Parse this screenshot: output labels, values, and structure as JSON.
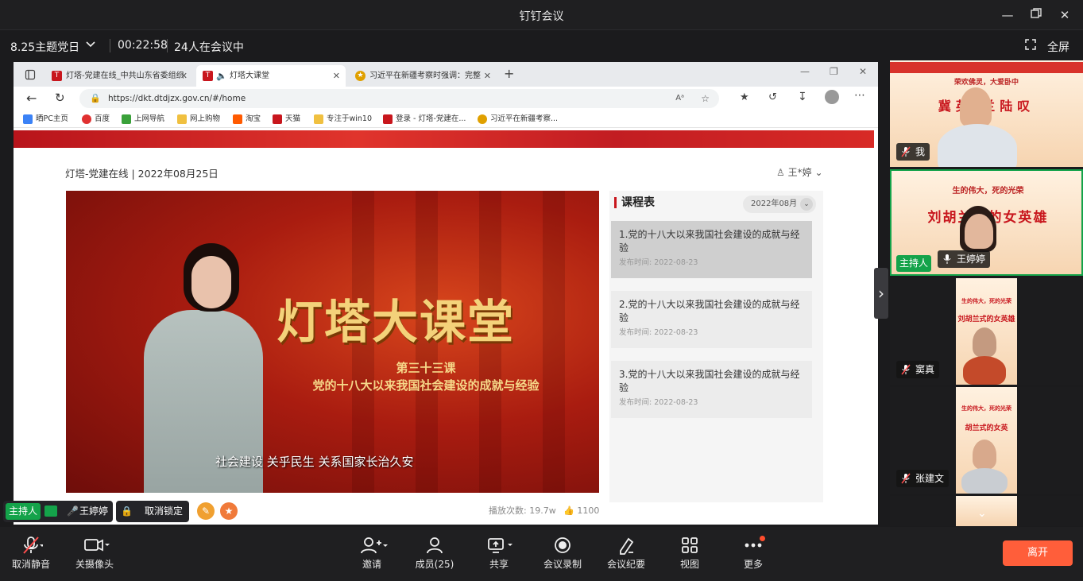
{
  "window": {
    "title": "钉钉会议"
  },
  "meeting": {
    "name": "8.25主题党日",
    "timer": "00:22:58",
    "count": "24人在会议中",
    "fullscreen_label": "全屏"
  },
  "browser": {
    "tabs": [
      {
        "label": "灯塔-党建在线_中共山东省委组织"
      },
      {
        "label": "灯塔大课堂"
      },
      {
        "label": "习近平在新疆考察时强调：完整"
      }
    ],
    "url": "https://dkt.dtdjzx.gov.cn/#/home",
    "bookmarks": [
      "晒PC主页",
      "百度",
      "上网导航",
      "网上购物",
      "淘宝",
      "天猫",
      "专注于win10",
      "登录 - 灯塔-党建在...",
      "习近平在新疆考察..."
    ]
  },
  "site": {
    "header": "灯塔-党建在线 | 2022年08月25日",
    "user": "王*婷",
    "video": {
      "title": "灯塔大课堂",
      "lesson": "第三十三课",
      "subtitle": "党的十八大以来我国社会建设的成就与经验",
      "caption": "社会建设  关乎民生  关系国家长治久安"
    },
    "plays": "播放次数: 19.7w",
    "likes": "1100",
    "schedule": {
      "title": "课程表",
      "month": "2022年08月",
      "courses": [
        {
          "title": "1.党的十八大以来我国社会建设的成就与经验",
          "date": "发布时间: 2022-08-23"
        },
        {
          "title": "2.党的十八大以来我国社会建设的成就与经验",
          "date": "发布时间: 2022-08-23"
        },
        {
          "title": "3.党的十八大以来我国社会建设的成就与经验",
          "date": "发布时间: 2022-08-23"
        }
      ]
    }
  },
  "share_controls": {
    "host_label": "主持人",
    "presenter": "王婷婷",
    "unlock_label": "取消锁定"
  },
  "participants": [
    {
      "name": "我",
      "poster_title": "冀英 兰陆叹",
      "poster_sub": "荣欢佛灵，大爱卧中"
    },
    {
      "name": "王婷婷",
      "host": "主持人",
      "poster_title": "刘胡兰式的女英雄",
      "poster_sub": "生的伟大，死的光荣"
    },
    {
      "name": "窦真",
      "poster_title": "刘胡兰式的女英雄",
      "poster_sub": "生的伟大，死的光荣"
    },
    {
      "name": "张建文",
      "poster_title": "胡兰式的女英",
      "poster_sub": "生的伟大，死的光荣"
    }
  ],
  "toolbar": {
    "mute": "取消静音",
    "camera": "关摄像头",
    "invite": "邀请",
    "members": "成员(25)",
    "share": "共享",
    "record": "会议录制",
    "minutes": "会议纪要",
    "view": "视图",
    "more": "更多",
    "leave": "离开"
  },
  "colors": {
    "accent": "#ff5e3a",
    "host_green": "#14a34a",
    "brand_red": "#c8161d"
  }
}
